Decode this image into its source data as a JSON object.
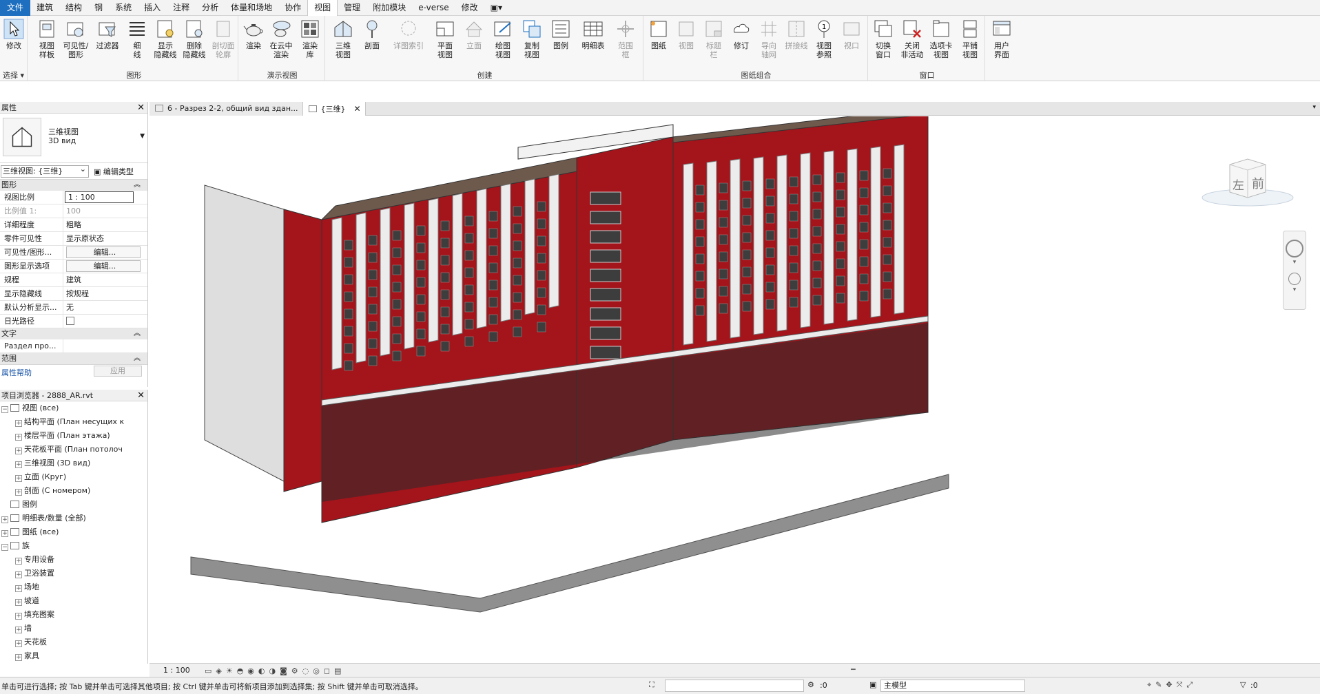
{
  "menu": {
    "tabs": [
      "文件",
      "建筑",
      "结构",
      "钢",
      "系统",
      "插入",
      "注释",
      "分析",
      "体量和场地",
      "协作",
      "视图",
      "管理",
      "附加模块",
      "e-verse",
      "修改"
    ],
    "active": "视图"
  },
  "ribbon": {
    "select": {
      "modify": "修改",
      "select_label": "选择"
    },
    "graphics": {
      "label": "图形",
      "view_template": "视图\n样板",
      "visibility": "可见性/\n图形",
      "filters": "过滤器",
      "thin_lines": "细\n线",
      "show_hidden": "显示\n隐藏线",
      "remove_hidden": "删除\n隐藏线",
      "cut_profile": "剖切面\n轮廓"
    },
    "presentation": {
      "label": "演示视图",
      "render": "渲染",
      "render_cloud": "在云中\n渲染",
      "render_gallery": "渲染\n库"
    },
    "create": {
      "label": "创建",
      "view3d": "三维\n视图",
      "section": "剖面",
      "callout": "详图索引",
      "plan_views": "平面\n视图",
      "elevation": "立面",
      "drafting": "绘图\n视图",
      "duplicate": "复制\n视图",
      "legend": "图例",
      "schedules": "明细表",
      "scope_box": "范围\n框"
    },
    "sheet": {
      "label": "图纸组合",
      "sheet": "图纸",
      "view": "视图",
      "title_block": "标题\n栏",
      "revisions": "修订",
      "guide_grid": "导向\n轴网",
      "matchline": "拼接线",
      "view_ref": "视图\n参照",
      "viewports": "视口"
    },
    "windows": {
      "label": "窗口",
      "switch": "切换\n窗口",
      "close_inactive": "关闭\n非活动",
      "tab_views": "选项卡\n视图",
      "tile_views": "平铺\n视图",
      "ui": "用户\n界面"
    }
  },
  "properties": {
    "title": "属性",
    "type_name_cn": "三维视图",
    "type_name_ru": "3D вид",
    "view_selector": "三维视图: {三维}",
    "edit_type": "编辑类型",
    "section_graphics": "图形",
    "rows": [
      {
        "k": "视图比例",
        "v": "1 : 100"
      },
      {
        "k": "比例值 1:",
        "v": "100"
      },
      {
        "k": "详细程度",
        "v": "粗略"
      },
      {
        "k": "零件可见性",
        "v": "显示原状态"
      },
      {
        "k": "可见性/图形...",
        "v": "编辑..."
      },
      {
        "k": "图形显示选项",
        "v": "编辑..."
      },
      {
        "k": "规程",
        "v": "建筑"
      },
      {
        "k": "显示隐藏线",
        "v": "按规程"
      },
      {
        "k": "默认分析显示...",
        "v": "无"
      },
      {
        "k": "日光路径",
        "v": ""
      }
    ],
    "section_text": "文字",
    "text_row": {
      "k": "Раздел про...",
      "v": ""
    },
    "section_extents": "范围",
    "help": "属性帮助",
    "apply": "应用"
  },
  "browser": {
    "title": "项目浏览器 - 2888_AR.rvt",
    "nodes": [
      {
        "lvl": 0,
        "t": "−",
        "label": "视图 (все)"
      },
      {
        "lvl": 1,
        "t": "+",
        "label": "结构平面 (План несущих к"
      },
      {
        "lvl": 1,
        "t": "+",
        "label": "楼层平面 (План этажа)"
      },
      {
        "lvl": 1,
        "t": "+",
        "label": "天花板平面 (План потолоч"
      },
      {
        "lvl": 1,
        "t": "+",
        "label": "三维视图 (3D вид)"
      },
      {
        "lvl": 1,
        "t": "+",
        "label": "立面 (Круг)"
      },
      {
        "lvl": 1,
        "t": "+",
        "label": "剖面 (С номером)"
      },
      {
        "lvl": 0,
        "t": "",
        "label": "图例"
      },
      {
        "lvl": 0,
        "t": "+",
        "label": "明细表/数量 (全部)"
      },
      {
        "lvl": 0,
        "t": "+",
        "label": "图纸 (все)"
      },
      {
        "lvl": 0,
        "t": "−",
        "label": "族"
      },
      {
        "lvl": 1,
        "t": "+",
        "label": "专用设备"
      },
      {
        "lvl": 1,
        "t": "+",
        "label": "卫浴装置"
      },
      {
        "lvl": 1,
        "t": "+",
        "label": "场地"
      },
      {
        "lvl": 1,
        "t": "+",
        "label": "坡道"
      },
      {
        "lvl": 1,
        "t": "+",
        "label": "填充图案"
      },
      {
        "lvl": 1,
        "t": "+",
        "label": "墙"
      },
      {
        "lvl": 1,
        "t": "+",
        "label": "天花板"
      },
      {
        "lvl": 1,
        "t": "+",
        "label": "家具"
      }
    ]
  },
  "doc_tabs": [
    {
      "label": "6 - Разрез 2-2, общий вид здан...",
      "active": false
    },
    {
      "label": "{三维}",
      "active": true
    }
  ],
  "viewcube": {
    "left": "左",
    "front": "前"
  },
  "view_control": {
    "scale": "1 : 100"
  },
  "status": {
    "message": "单击可进行选择; 按 Tab 键并单击可选择其他项目; 按 Ctrl 键并单击可将新项目添加到选择集; 按 Shift 键并单击可取消选择。",
    "selection_count": ":0",
    "model": "主模型",
    "filter_count": ":0"
  },
  "colors": {
    "brick": "#a3141b",
    "file_tab": "#1e6fbf",
    "facade_white": "#ececec",
    "roof": "#6e5a4c"
  }
}
